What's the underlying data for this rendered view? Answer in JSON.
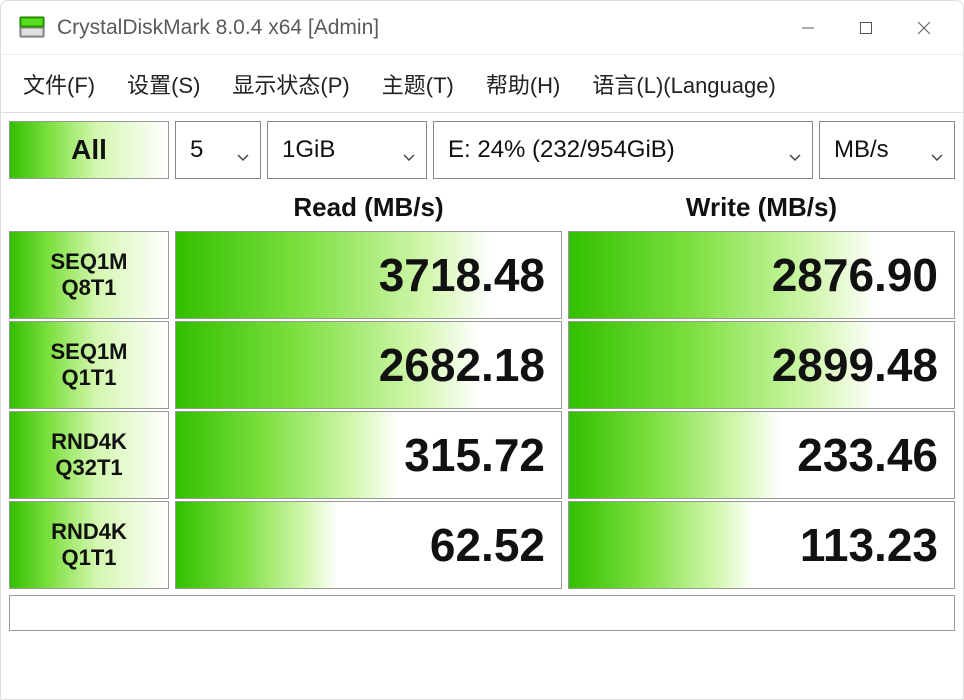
{
  "title": "CrystalDiskMark 8.0.4 x64 [Admin]",
  "menu": {
    "file": "文件(F)",
    "settings": "设置(S)",
    "display": "显示状态(P)",
    "theme": "主题(T)",
    "help": "帮助(H)",
    "language": "语言(L)(Language)"
  },
  "controls": {
    "all_label": "All",
    "count": "5",
    "size": "1GiB",
    "drive": "E: 24% (232/954GiB)",
    "unit": "MB/s"
  },
  "headers": {
    "read": "Read (MB/s)",
    "write": "Write (MB/s)"
  },
  "tests": [
    {
      "line1": "SEQ1M",
      "line2": "Q8T1",
      "read": "3718.48",
      "write": "2876.90",
      "read_pct": 82,
      "write_pct": 80
    },
    {
      "line1": "SEQ1M",
      "line2": "Q1T1",
      "read": "2682.18",
      "write": "2899.48",
      "read_pct": 79,
      "write_pct": 80
    },
    {
      "line1": "RND4K",
      "line2": "Q32T1",
      "read": "315.72",
      "write": "233.46",
      "read_pct": 58,
      "write_pct": 55
    },
    {
      "line1": "RND4K",
      "line2": "Q1T1",
      "read": "62.52",
      "write": "113.23",
      "read_pct": 42,
      "write_pct": 48
    }
  ]
}
